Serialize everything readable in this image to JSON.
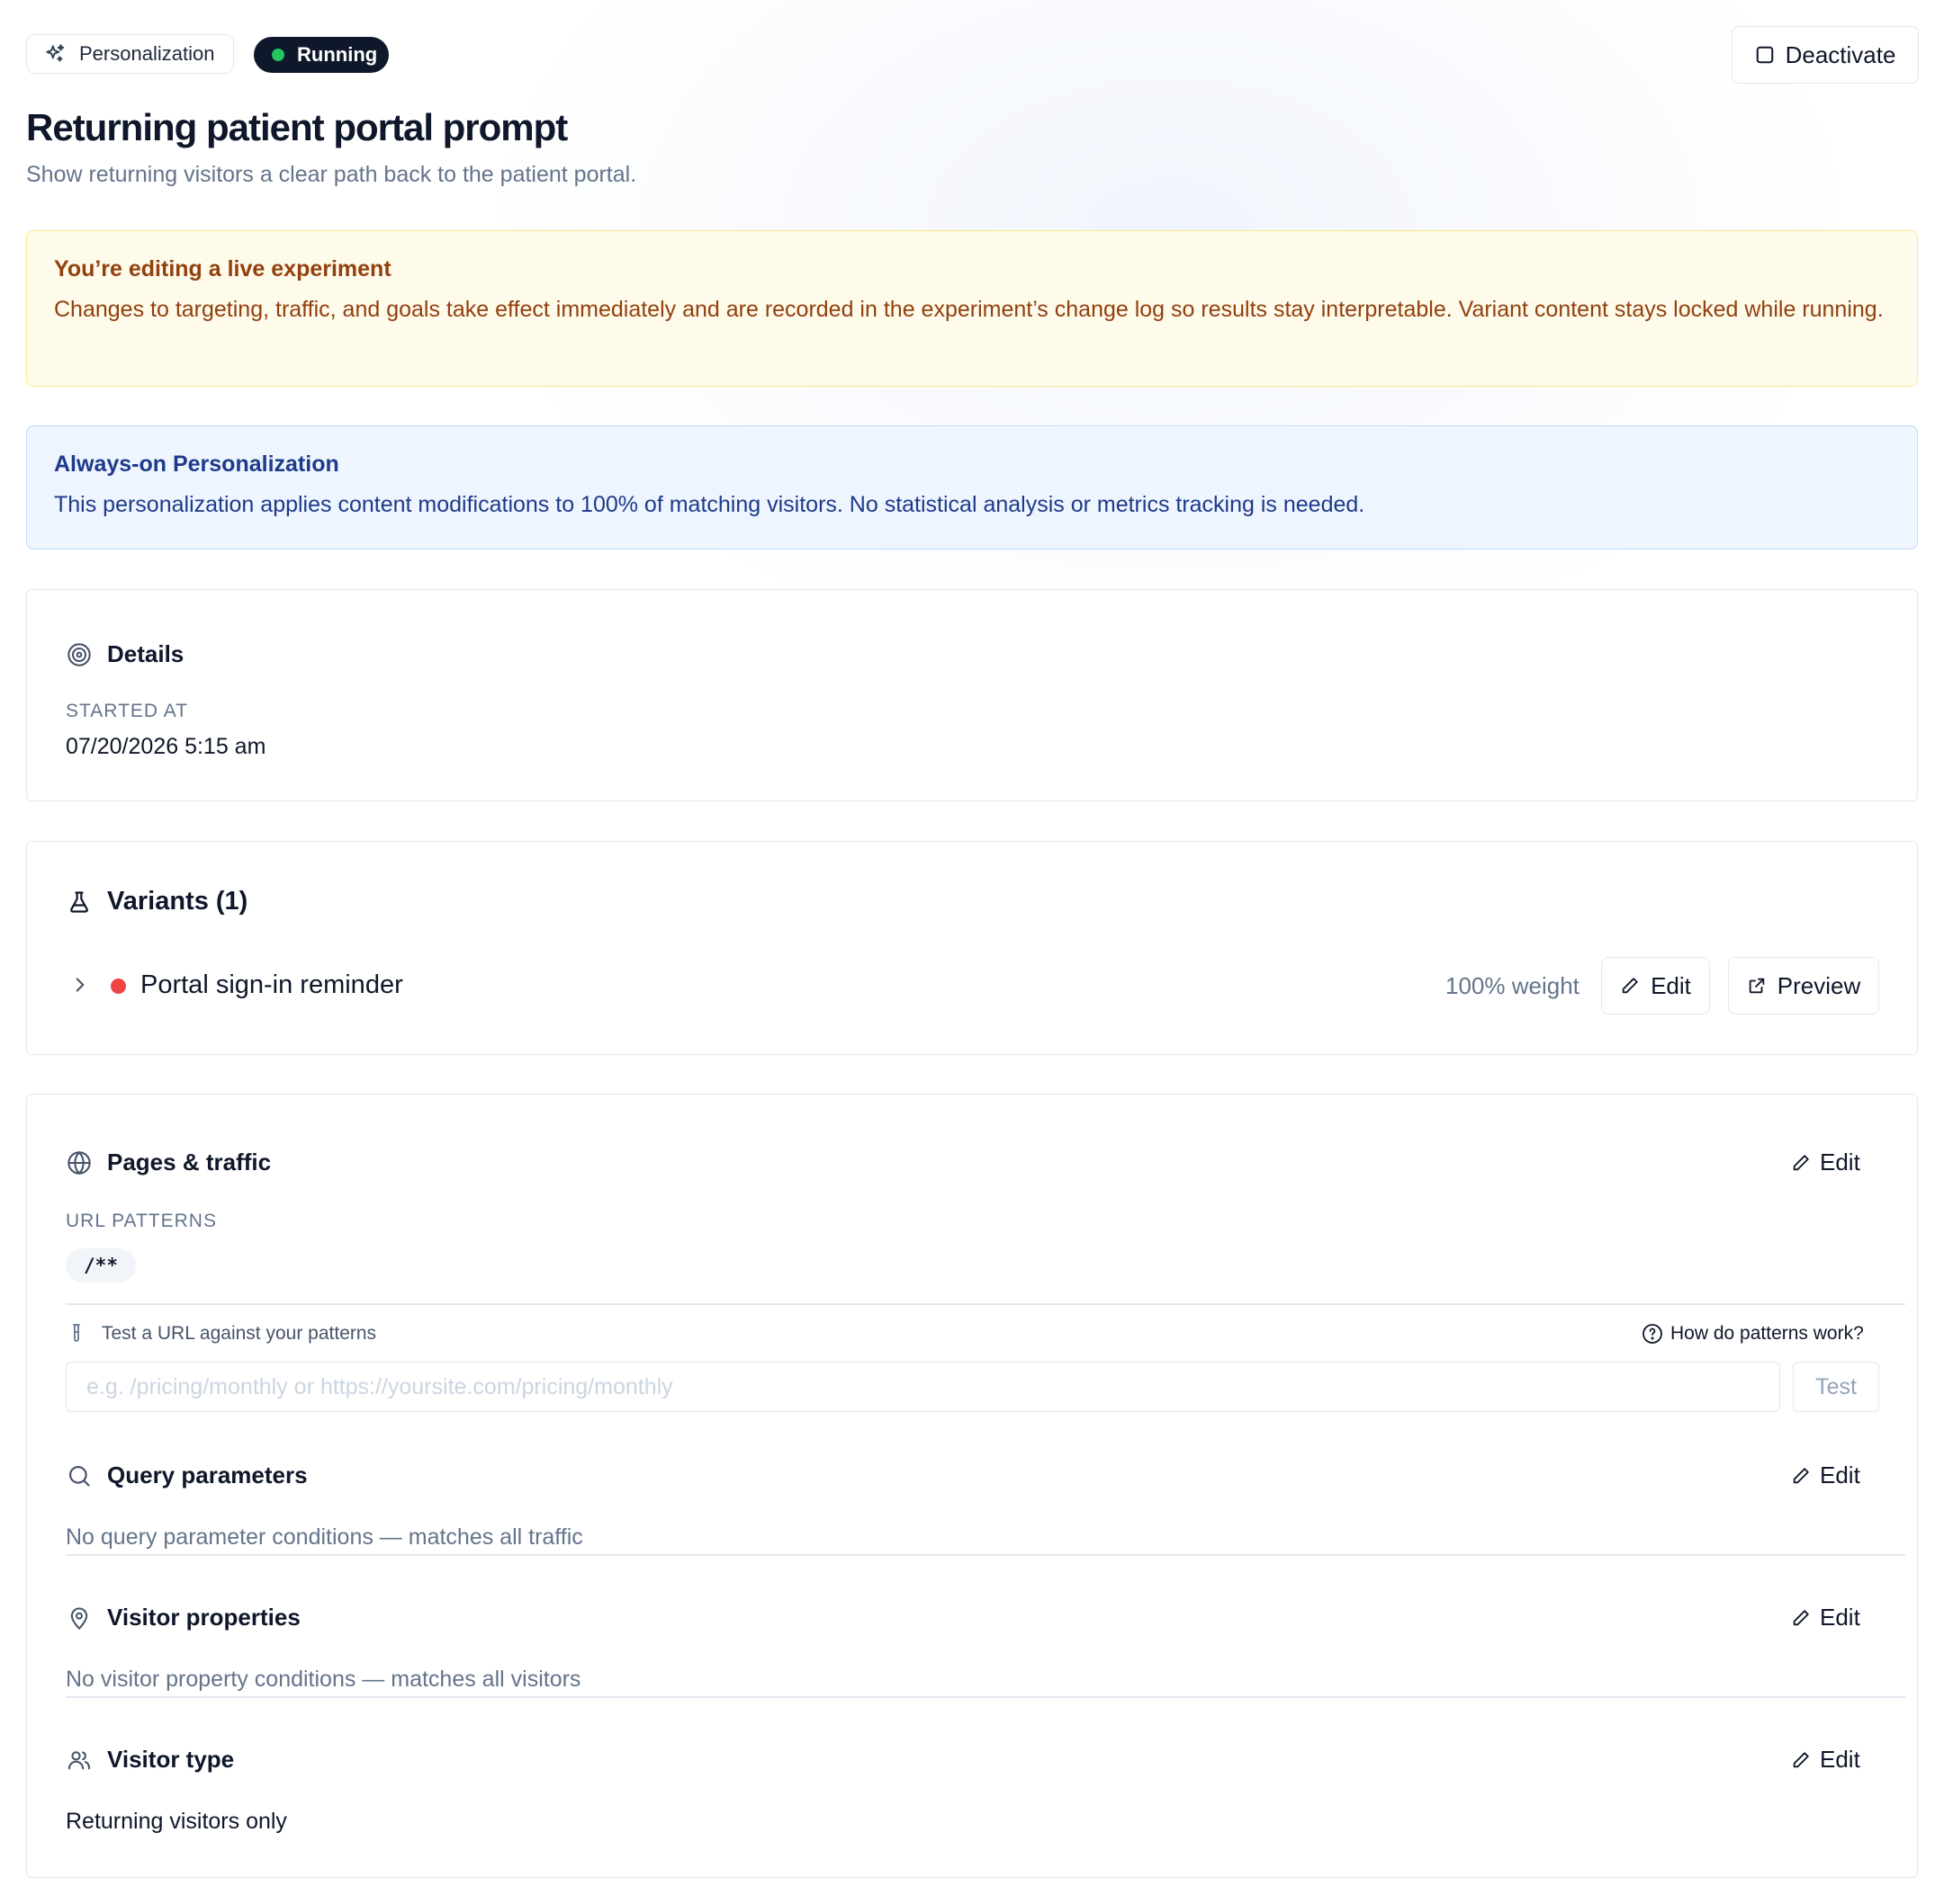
{
  "header": {
    "type_label": "Personalization",
    "status_label": "Running",
    "status_color": "#22c55e",
    "deactivate_label": "Deactivate",
    "title": "Returning patient portal prompt",
    "subtitle": "Show returning visitors a clear path back to the patient portal."
  },
  "warning": {
    "title": "You’re editing a live experiment",
    "body": "Changes to targeting, traffic, and goals take effect immediately and are recorded in the experiment’s change log so results stay interpretable. Variant content stays locked while running."
  },
  "info": {
    "title": "Always-on Personalization",
    "body": "This personalization applies content modifications to 100% of matching visitors. No statistical analysis or metrics tracking is needed."
  },
  "details": {
    "heading": "Details",
    "started_label": "STARTED AT",
    "started_value": "07/20/2026 5:15 am"
  },
  "variants": {
    "heading": "Variants (1)",
    "items": [
      {
        "name": "Portal sign-in reminder",
        "color": "#ef4444",
        "weight": "100% weight",
        "edit_label": "Edit",
        "preview_label": "Preview"
      }
    ]
  },
  "pages": {
    "heading": "Pages & traffic",
    "edit_label": "Edit",
    "url_patterns_label": "URL PATTERNS",
    "patterns": [
      "/**"
    ],
    "test_label": "Test a URL against your patterns",
    "help_label": "How do patterns work?",
    "test_placeholder": "e.g. /pricing/monthly or https://yoursite.com/pricing/monthly",
    "test_button": "Test"
  },
  "query": {
    "heading": "Query parameters",
    "edit_label": "Edit",
    "value": "No query parameter conditions — matches all traffic"
  },
  "visitor_props": {
    "heading": "Visitor properties",
    "edit_label": "Edit",
    "value": "No visitor property conditions — matches all visitors"
  },
  "visitor_type": {
    "heading": "Visitor type",
    "edit_label": "Edit",
    "value": "Returning visitors only"
  }
}
